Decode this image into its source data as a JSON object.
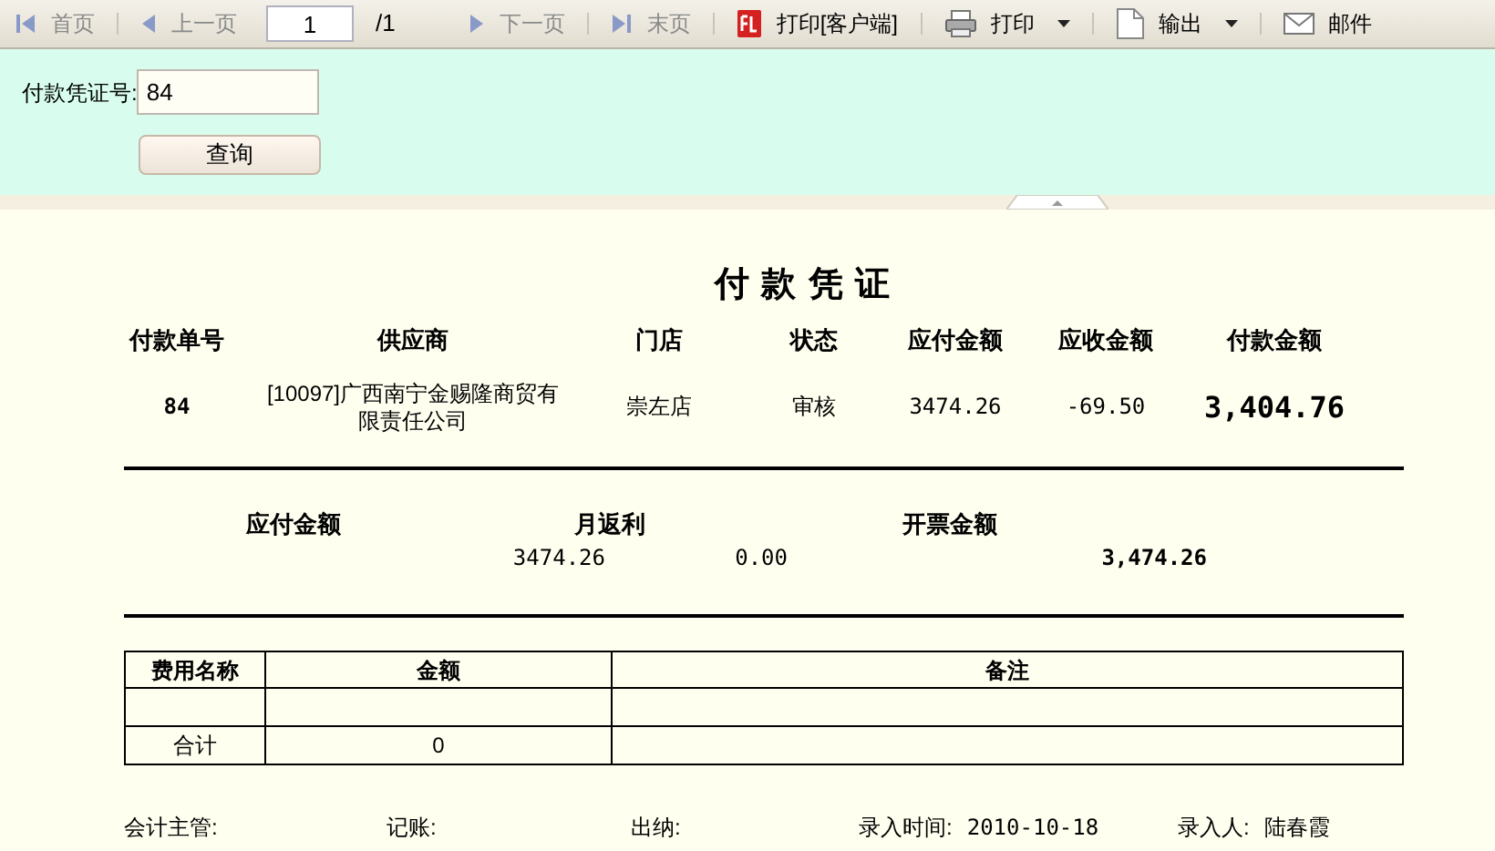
{
  "toolbar": [
    {
      "kind": "first",
      "label": "首页",
      "disabled": true
    },
    {
      "kind": "prev",
      "label": "上一页",
      "disabled": true
    },
    {
      "kind": "page",
      "value": "1",
      "total": "/1"
    },
    {
      "kind": "next",
      "label": "下一页",
      "disabled": true
    },
    {
      "kind": "last",
      "label": "末页",
      "disabled": true
    },
    {
      "kind": "flash",
      "label": "打印[客户端]",
      "disabled": false
    },
    {
      "kind": "print",
      "label": "打印",
      "disabled": false,
      "dropdown": true
    },
    {
      "kind": "export",
      "label": "输出",
      "disabled": false,
      "dropdown": true
    },
    {
      "kind": "mail",
      "label": "邮件",
      "disabled": false
    }
  ],
  "query": {
    "label": "付款凭证号:",
    "value": "84",
    "button": "查询"
  },
  "report": {
    "title": "付 款 凭 证",
    "columns": [
      "付款单号",
      "供应商",
      "门店",
      "状态",
      "应付金额",
      "应收金额",
      "付款金额"
    ],
    "row": [
      "84",
      "[10097]广西南宁金赐隆商贸有限责任公司",
      "崇左店",
      "审核",
      "3474.26",
      "-69.50",
      "3,404.76"
    ],
    "summary_labels": [
      "应付金额",
      "月返利",
      "开票金额"
    ],
    "summary_values": [
      "3474.26",
      "0.00",
      "3,474.26"
    ],
    "fees": {
      "columns": [
        "费用名称",
        "金额",
        "备注"
      ],
      "rows": [
        [
          "",
          "",
          ""
        ],
        [
          "合计",
          "0",
          ""
        ]
      ]
    },
    "footer": [
      {
        "label": "会计主管:"
      },
      {
        "label": "记账:"
      },
      {
        "label": "出纳:"
      },
      {
        "label": "录入时间:",
        "value": "2010-10-18"
      },
      {
        "label": "录入人:",
        "value": "陆春霞"
      }
    ]
  }
}
